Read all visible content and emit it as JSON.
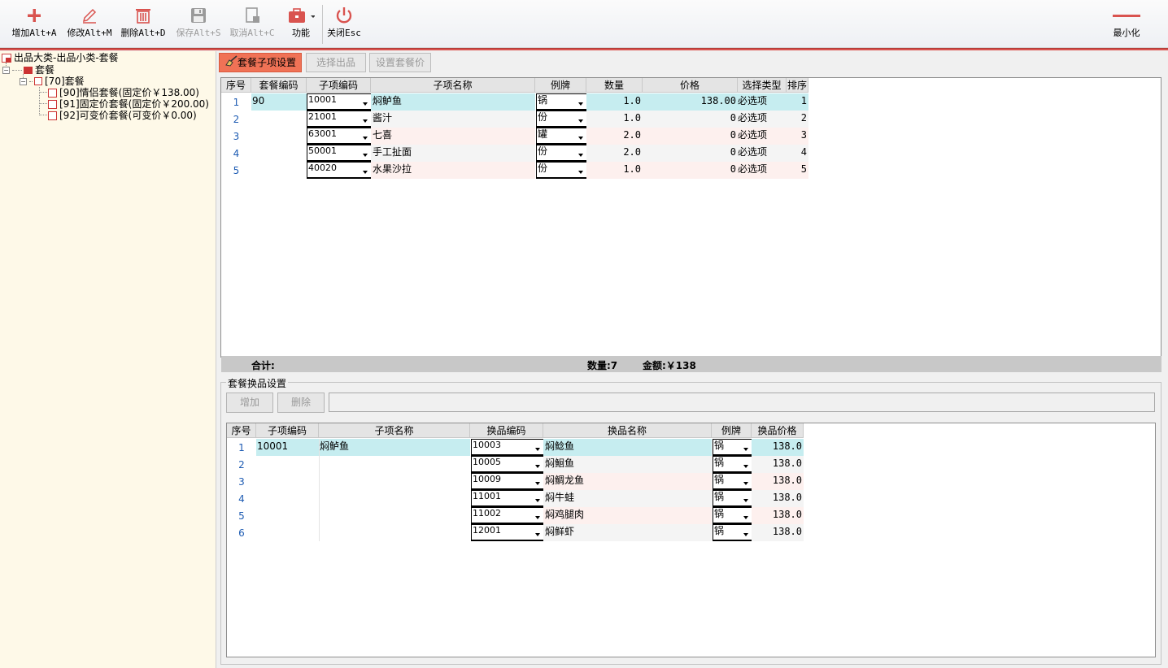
{
  "toolbar": {
    "add": "增加Alt+A",
    "edit": "修改Alt+M",
    "delete": "删除Alt+D",
    "save": "保存Alt+S",
    "cancel": "取消Alt+C",
    "func": "功能",
    "close": "关闭Esc",
    "minimize": "最小化"
  },
  "tree": {
    "root": "出品大类-出品小类-套餐",
    "level1": "套餐",
    "level2": "[70]套餐",
    "items": [
      "[90]情侣套餐(固定价￥138.00)",
      "[91]固定价套餐(固定价￥200.00)",
      "[92]可变价套餐(可变价￥0.00)"
    ]
  },
  "tabs": [
    "套餐子项设置",
    "选择出品",
    "设置套餐价"
  ],
  "grid1": {
    "headers": [
      "序号",
      "套餐编码",
      "子项编码",
      "子项名称",
      "例牌",
      "数量",
      "价格",
      "选择类型",
      "排序"
    ],
    "set_code": "90",
    "rows": [
      {
        "no": "1",
        "code": "10001",
        "name": "焖鲈鱼",
        "unit": "锅",
        "qty": "1.0",
        "price": "138.00",
        "type": "必选项",
        "sort": "1"
      },
      {
        "no": "2",
        "code": "21001",
        "name": "酱汁",
        "unit": "份",
        "qty": "1.0",
        "price": "0",
        "type": "必选项",
        "sort": "2"
      },
      {
        "no": "3",
        "code": "63001",
        "name": "七喜",
        "unit": "罐",
        "qty": "2.0",
        "price": "0",
        "type": "必选项",
        "sort": "3"
      },
      {
        "no": "4",
        "code": "50001",
        "name": "手工扯面",
        "unit": "份",
        "qty": "2.0",
        "price": "0",
        "type": "必选项",
        "sort": "4"
      },
      {
        "no": "5",
        "code": "40020",
        "name": "水果沙拉",
        "unit": "份",
        "qty": "1.0",
        "price": "0",
        "type": "必选项",
        "sort": "5"
      }
    ]
  },
  "totals": {
    "label": "合计:",
    "qty": "数量:7",
    "amount": "金额:￥138"
  },
  "group2": {
    "title": "套餐换品设置",
    "add_btn": "增加",
    "del_btn": "删除"
  },
  "grid2": {
    "headers": [
      "序号",
      "子项编码",
      "子项名称",
      "换品编码",
      "换品名称",
      "例牌",
      "换品价格"
    ],
    "item_code": "10001",
    "item_name": "焖鲈鱼",
    "rows": [
      {
        "no": "1",
        "code": "10003",
        "name": "焖鲶鱼",
        "unit": "锅",
        "price": "138.0"
      },
      {
        "no": "2",
        "code": "10005",
        "name": "焖鮰鱼",
        "unit": "锅",
        "price": "138.0"
      },
      {
        "no": "3",
        "code": "10009",
        "name": "焖鲷龙鱼",
        "unit": "锅",
        "price": "138.0"
      },
      {
        "no": "4",
        "code": "11001",
        "name": "焖牛蛙",
        "unit": "锅",
        "price": "138.0"
      },
      {
        "no": "5",
        "code": "11002",
        "name": "焖鸡腿肉",
        "unit": "锅",
        "price": "138.0"
      },
      {
        "no": "6",
        "code": "12001",
        "name": "焖鲜虾",
        "unit": "锅",
        "price": "138.0"
      }
    ]
  },
  "colors": {
    "accent": "#d9534f",
    "active_tab": "#f07256",
    "row_selected": "#c6edf0",
    "row_pink": "#fdf0ee",
    "row_gray": "#f4f4f4"
  }
}
